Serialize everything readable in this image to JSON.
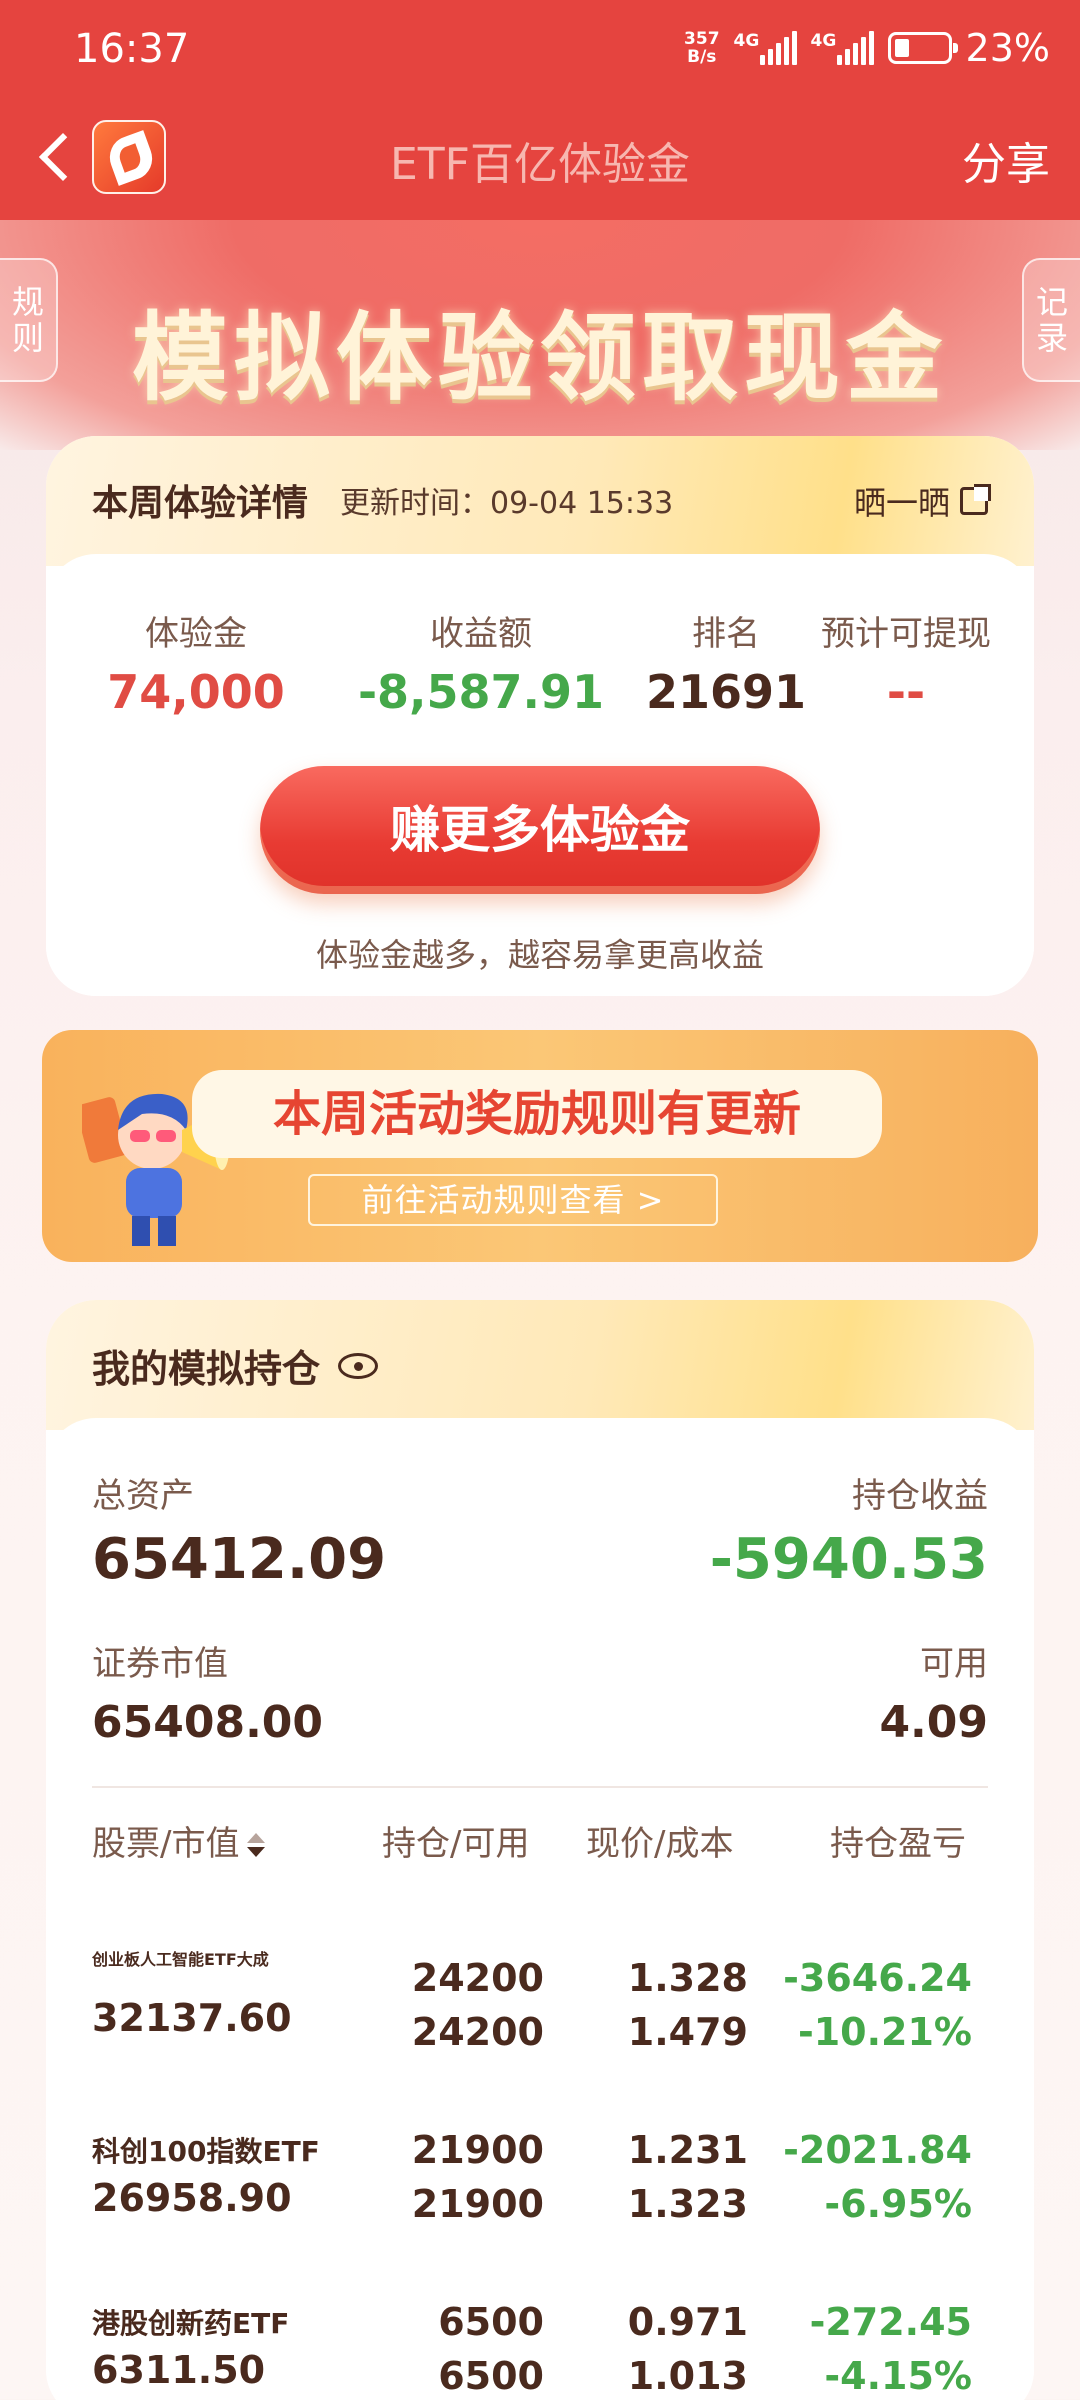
{
  "status_bar": {
    "time": "16:37",
    "net_speed_value": "357",
    "net_speed_unit": "B/s",
    "signal1_label": "4G",
    "signal2_label": "4G",
    "battery": "23%"
  },
  "nav": {
    "title": "ETF百亿体验金",
    "share": "分享"
  },
  "banner": {
    "title": "模拟体验领取现金",
    "left_tab": "规则",
    "right_tab": "记录"
  },
  "week_card": {
    "title": "本周体验详情",
    "update_label": "更新时间：",
    "update_time": "09-04 15:33",
    "share_label": "晒一晒",
    "stats": [
      {
        "label": "体验金",
        "value": "74,000",
        "color": "#e04c44"
      },
      {
        "label": "收益额",
        "value": "-8,587.91",
        "color": "#45a84a"
      },
      {
        "label": "排名",
        "value": "21691",
        "color": "#4a2a1e"
      },
      {
        "label": "预计可提现",
        "value": "--",
        "color": "#e04c44"
      }
    ],
    "earn_button": "赚更多体验金",
    "tip": "体验金越多，越容易拿更高收益"
  },
  "promo": {
    "headline": "本周活动奖励规则有更新",
    "link": "前往活动规则查看 >"
  },
  "holdings": {
    "title": "我的模拟持仓",
    "total_assets_label": "总资产",
    "total_assets": "65412.09",
    "pnl_label": "持仓收益",
    "pnl": "-5940.53",
    "market_value_label": "证券市值",
    "market_value": "65408.00",
    "available_label": "可用",
    "available": "4.09",
    "columns": {
      "stock": "股票/市值",
      "position": "持仓/可用",
      "price": "现价/成本",
      "profit": "持仓盈亏"
    },
    "rows": [
      {
        "name": "创业板人工智能ETF大成",
        "market_value": "32137.60",
        "position": "24200",
        "available": "24200",
        "price": "1.328",
        "cost": "1.479",
        "pnl": "-3646.24",
        "pnl_pct": "-10.21%"
      },
      {
        "name": "科创100指数ETF",
        "market_value": "26958.90",
        "position": "21900",
        "available": "21900",
        "price": "1.231",
        "cost": "1.323",
        "pnl": "-2021.84",
        "pnl_pct": "-6.95%"
      },
      {
        "name": "港股创新药ETF",
        "market_value": "6311.50",
        "position": "6500",
        "available": "6500",
        "price": "0.971",
        "cost": "1.013",
        "pnl": "-272.45",
        "pnl_pct": "-4.15%"
      }
    ]
  }
}
